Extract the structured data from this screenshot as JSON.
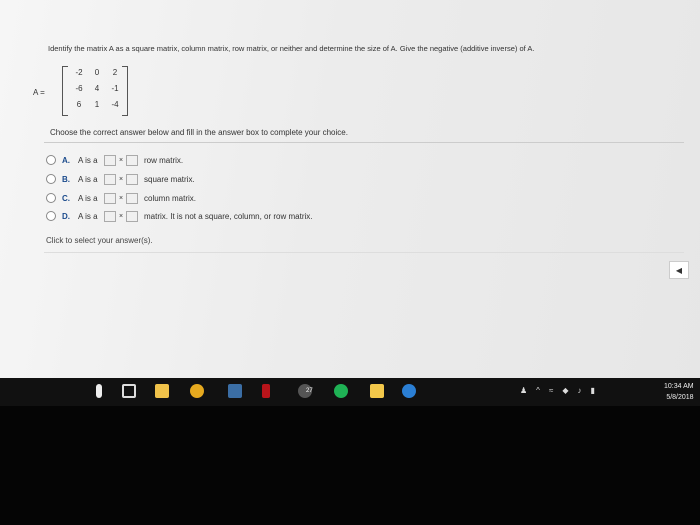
{
  "question": "Identify the matrix A as a square matrix, column matrix, row matrix, or neither and determine the size of A. Give the negative (additive inverse) of A.",
  "matrix_label": "A =",
  "matrix_rows": [
    [
      "-2",
      "0",
      "2"
    ],
    [
      "-6",
      "4",
      "-1"
    ],
    [
      "6",
      "1",
      "-4"
    ]
  ],
  "instruction": "Choose the correct answer below and fill in the answer box to complete your choice.",
  "choices": [
    {
      "letter": "A.",
      "prefix": "A is a",
      "times": "×",
      "desc": "row matrix."
    },
    {
      "letter": "B.",
      "prefix": "A is a",
      "times": "×",
      "desc": "square matrix."
    },
    {
      "letter": "C.",
      "prefix": "A is a",
      "times": "×",
      "desc": "column matrix."
    },
    {
      "letter": "D.",
      "prefix": "A is a",
      "times": "×",
      "desc": "matrix. It is not a square, column, or row matrix."
    }
  ],
  "click_text": "Click to select your answer(s).",
  "nav_back_icon": "◀",
  "taskbar": {
    "icons": [
      "search-icon",
      "task-view-icon",
      "store-icon",
      "chrome-icon",
      "pandora-icon",
      "netflix-icon",
      "notification-badge-icon",
      "spotify-icon",
      "folder-icon",
      "edge-icon"
    ],
    "badge_count": "27"
  },
  "clock": {
    "time": "10:34 AM",
    "date": "5/8/2018"
  }
}
